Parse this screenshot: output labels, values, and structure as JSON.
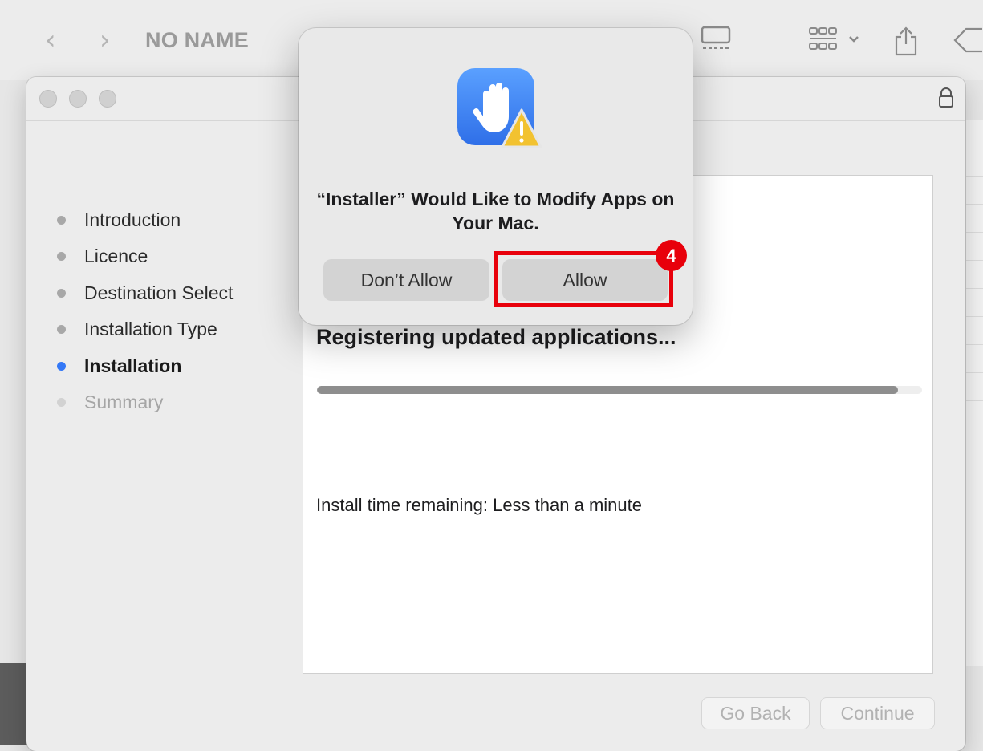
{
  "finder": {
    "title": "NO NAME",
    "back_glyph": "‹",
    "forward_glyph": "›"
  },
  "installer": {
    "steps": [
      {
        "label": "Introduction",
        "state": "done"
      },
      {
        "label": "Licence",
        "state": "done"
      },
      {
        "label": "Destination Select",
        "state": "done"
      },
      {
        "label": "Installation Type",
        "state": "done"
      },
      {
        "label": "Installation",
        "state": "active"
      },
      {
        "label": "Summary",
        "state": "pending"
      }
    ],
    "status": "Registering updated applications...",
    "progress_fraction": 0.96,
    "time_remaining": "Install time remaining: Less than a minute",
    "go_back_label": "Go Back",
    "continue_label": "Continue"
  },
  "alert": {
    "title": "“Installer” Would Like to Modify Apps on Your Mac.",
    "dont_allow_label": "Don’t Allow",
    "allow_label": "Allow",
    "icon": "privacy-hand-warning-icon"
  },
  "annotation": {
    "step_number": "4",
    "color": "#e8000b"
  },
  "colors": {
    "accent": "#3478f6",
    "alert_icon_blue": "#3b82f6",
    "warning_yellow": "#f2c230"
  }
}
